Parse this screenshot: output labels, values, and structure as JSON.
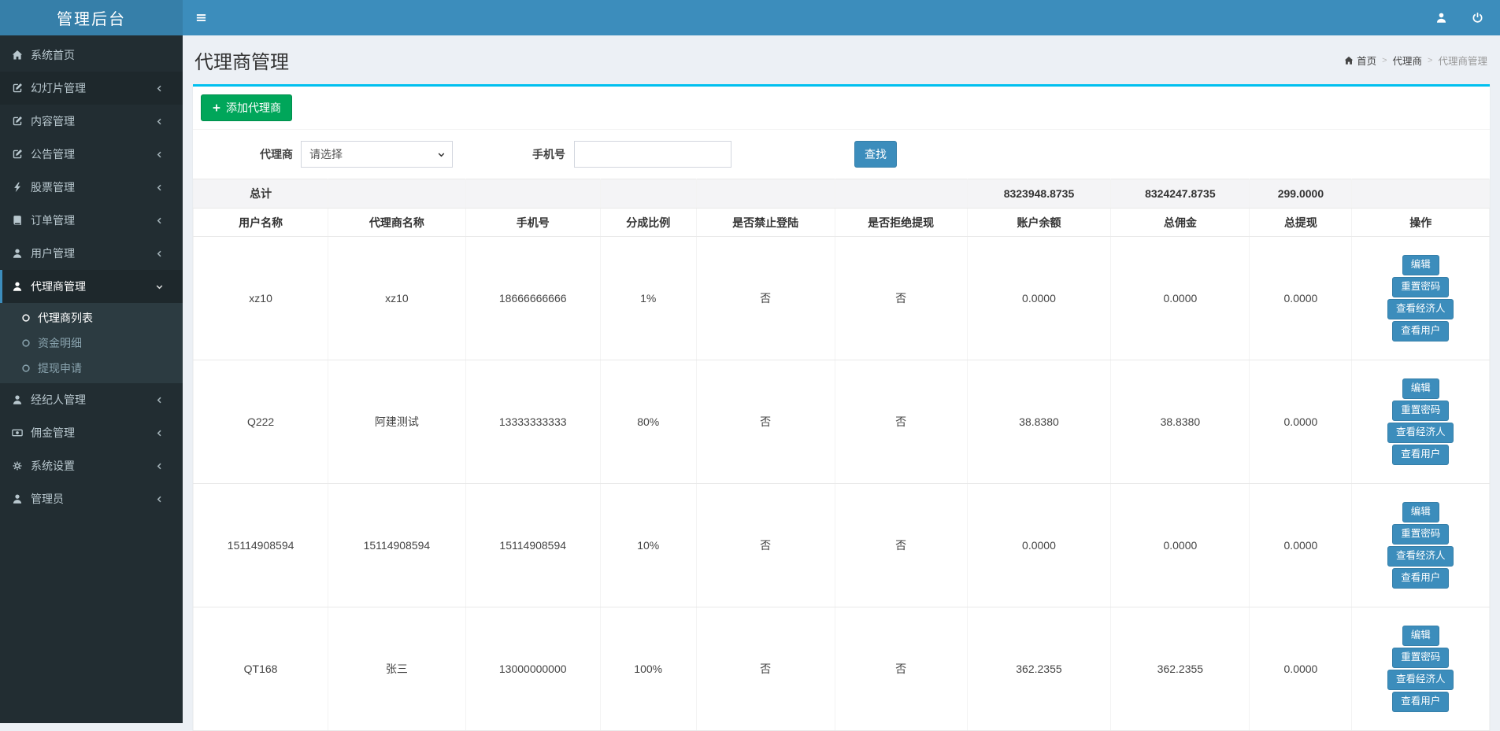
{
  "app": {
    "title": "管理后台"
  },
  "topbar": {
    "icons": [
      "hamburger-icon",
      "user-icon",
      "power-icon"
    ]
  },
  "sidebar": {
    "items": [
      {
        "label": "系统首页",
        "icon": "home-icon",
        "expandable": false
      },
      {
        "label": "幻灯片管理",
        "icon": "edit-icon",
        "expandable": true,
        "hovered": true
      },
      {
        "label": "内容管理",
        "icon": "edit-icon",
        "expandable": true
      },
      {
        "label": "公告管理",
        "icon": "edit-icon",
        "expandable": true
      },
      {
        "label": "股票管理",
        "icon": "bolt-icon",
        "expandable": true
      },
      {
        "label": "订单管理",
        "icon": "book-icon",
        "expandable": true
      },
      {
        "label": "用户管理",
        "icon": "user-icon",
        "expandable": true
      },
      {
        "label": "代理商管理",
        "icon": "user-icon",
        "expandable": true,
        "active": true,
        "expanded": true,
        "children": [
          {
            "label": "代理商列表",
            "active": true
          },
          {
            "label": "资金明细"
          },
          {
            "label": "提现申请"
          }
        ]
      },
      {
        "label": "经纪人管理",
        "icon": "user-icon",
        "expandable": true
      },
      {
        "label": "佣金管理",
        "icon": "money-icon",
        "expandable": true
      },
      {
        "label": "系统设置",
        "icon": "gear-icon",
        "expandable": true
      },
      {
        "label": "管理员",
        "icon": "user-icon",
        "expandable": true
      }
    ]
  },
  "page": {
    "title": "代理商管理",
    "breadcrumb": [
      "首页",
      "代理商",
      "代理商管理"
    ]
  },
  "toolbar": {
    "add_button": "添加代理商"
  },
  "filters": {
    "agent_label": "代理商",
    "agent_selected": "请选择",
    "phone_label": "手机号",
    "phone_value": "",
    "search_button": "查找"
  },
  "table": {
    "totals": [
      "总计",
      "",
      "",
      "",
      "",
      "",
      "8323948.8735",
      "8324247.8735",
      "299.0000",
      ""
    ],
    "columns": [
      "用户名称",
      "代理商名称",
      "手机号",
      "分成比例",
      "是否禁止登陆",
      "是否拒绝提现",
      "账户余额",
      "总佣金",
      "总提现",
      "操作"
    ],
    "rows": [
      {
        "cells": [
          "xz10",
          "xz10",
          "18666666666",
          "1%",
          "否",
          "否",
          "0.0000",
          "0.0000",
          "0.0000"
        ]
      },
      {
        "cells": [
          "Q222",
          "阿建测试",
          "13333333333",
          "80%",
          "否",
          "否",
          "38.8380",
          "38.8380",
          "0.0000"
        ]
      },
      {
        "cells": [
          "15114908594",
          "15114908594",
          "15114908594",
          "10%",
          "否",
          "否",
          "0.0000",
          "0.0000",
          "0.0000"
        ]
      },
      {
        "cells": [
          "QT168",
          "张三",
          "13000000000",
          "100%",
          "否",
          "否",
          "362.2355",
          "362.2355",
          "0.0000"
        ]
      }
    ],
    "actions": [
      "编辑",
      "重置密码",
      "查看经济人",
      "查看用户"
    ]
  },
  "colors": {
    "navbar": "#3c8dbc",
    "logo": "#367fa9",
    "sidebar": "#222d32",
    "accent_button": "#3c8dbc",
    "success_button": "#00a65a",
    "box_top_border": "#00c0ef"
  }
}
